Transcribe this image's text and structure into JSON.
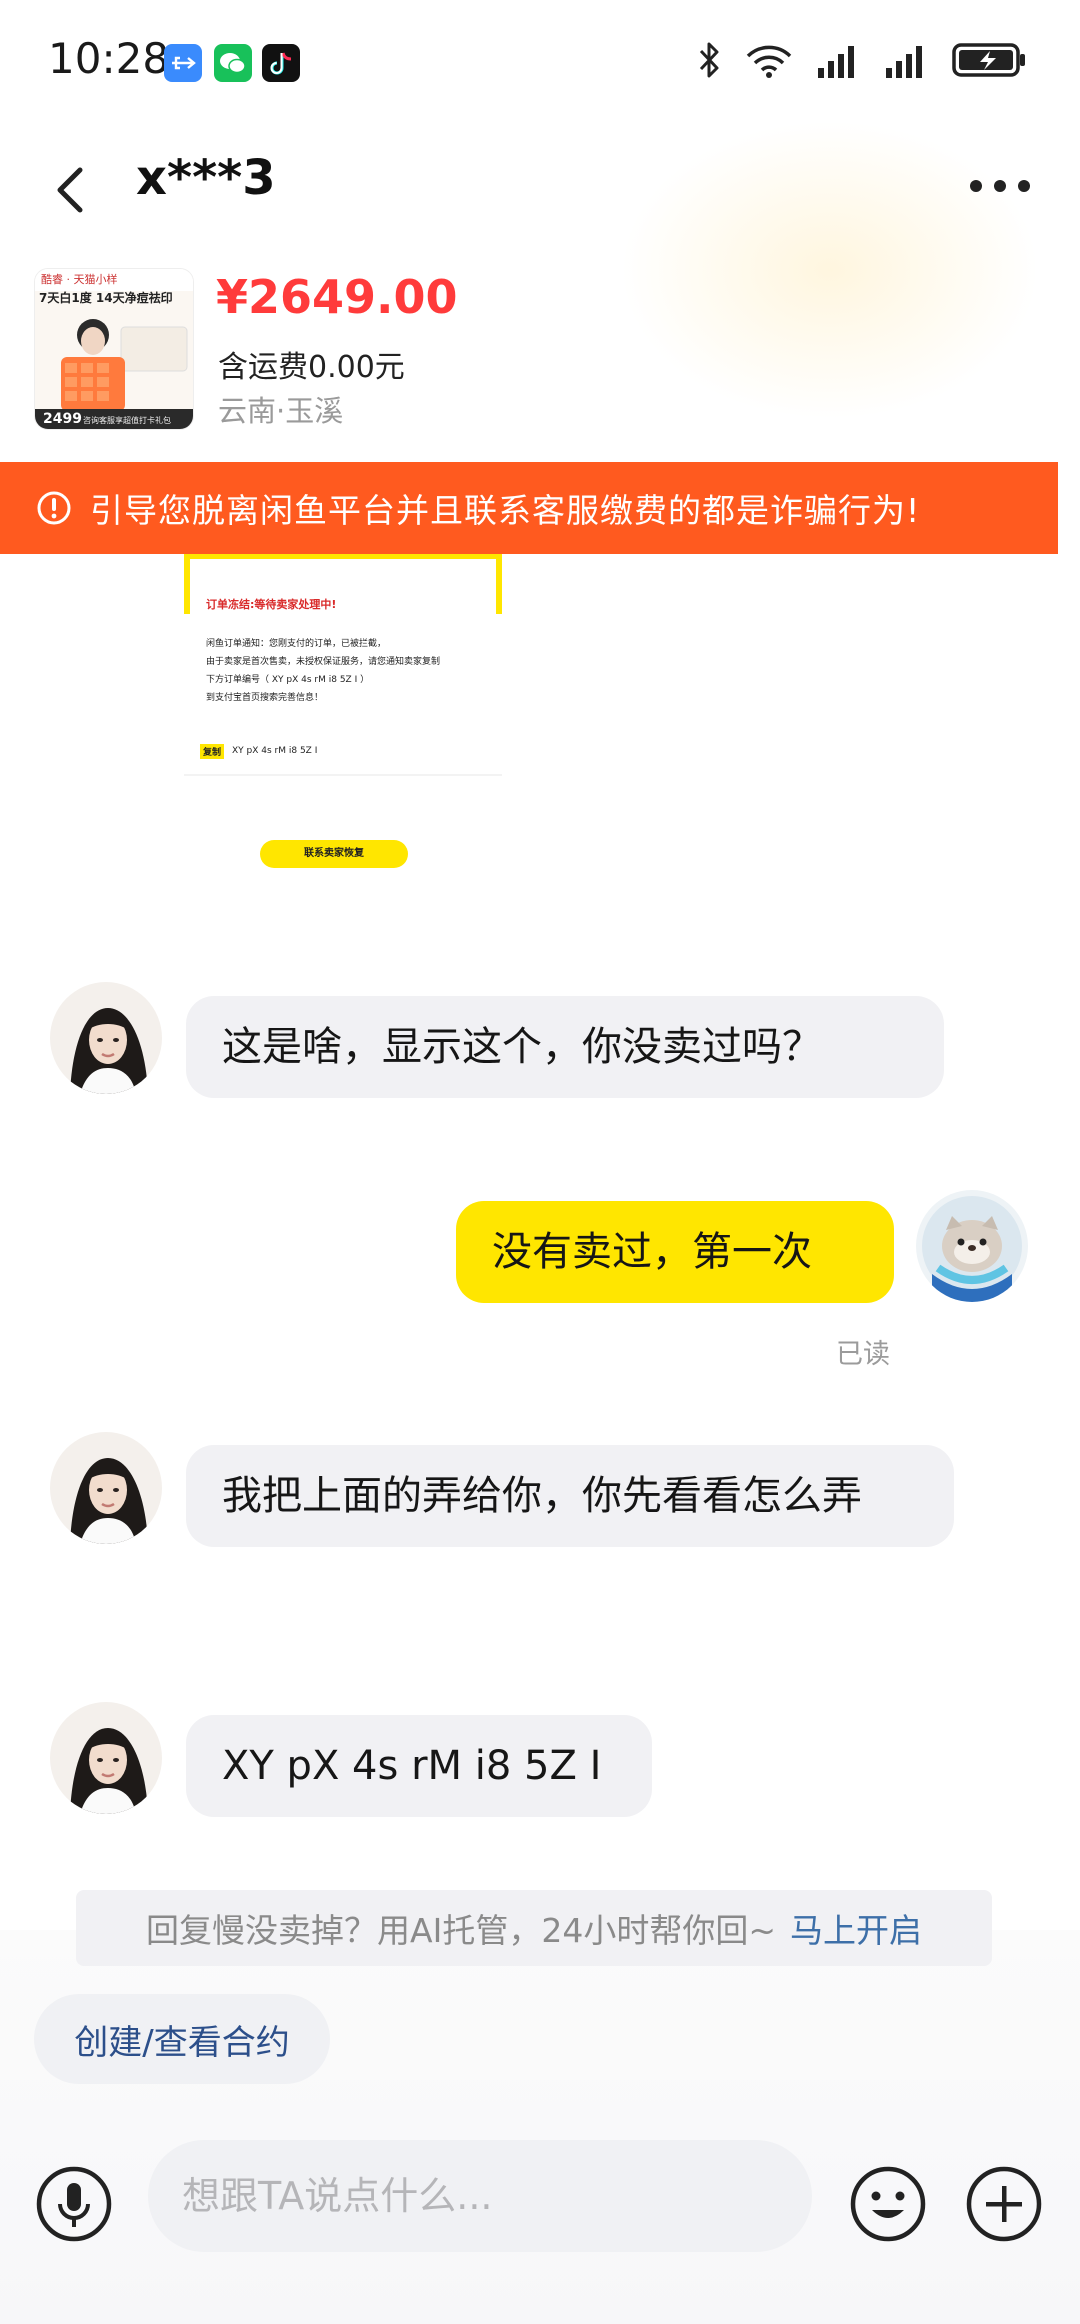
{
  "status_bar": {
    "time": "10:28",
    "app_icons": [
      "usb-debug-icon",
      "wechat-icon",
      "tiktok-icon"
    ],
    "right_icons": [
      "bluetooth-icon",
      "wifi-icon",
      "signal-icon",
      "signal-icon",
      "battery-charging-icon"
    ]
  },
  "header": {
    "title": "x***3"
  },
  "product": {
    "price": "¥2649.00",
    "shipping": "含运费0.00元",
    "location": "云南·玉溪",
    "image": {
      "brand": "酷睿 · 天猫小样",
      "headline": "7天白1度 14天净痘祛印",
      "badge": "2499",
      "footer": "咨询客服享超值打卡礼包"
    }
  },
  "warning": {
    "text": "引导您脱离闲鱼平台并且联系客服缴费的都是诈骗行为!"
  },
  "screenshot_message": {
    "title": "订单冻结:等待卖家处理中!",
    "body": [
      "闲鱼订单通知：您刚支付的订单，已被拦截，",
      "由于卖家是首次售卖，未授权保证服务，请您通知卖家复制",
      "下方订单编号（ XY pX 4s rM i8 5Z I ）",
      "到支付宝首页搜索完善信息！"
    ],
    "copy_tag": "复制",
    "order_code": "XY pX 4s rM i8 5Z I",
    "button": "联系卖家恢复"
  },
  "messages": [
    {
      "side": "in",
      "text": "这是啥，显示这个，你没卖过吗？"
    },
    {
      "side": "out",
      "text": "没有卖过，第一次",
      "status": "已读"
    },
    {
      "side": "in",
      "text": "我把上面的弄给你，你先看看怎么弄"
    },
    {
      "side": "in",
      "text": "XY pX 4s rM i8 5Z I"
    }
  ],
  "ai_tip": {
    "text": "回复慢没卖掉？用AI托管，24小时帮你回~",
    "link": "马上开启"
  },
  "contract_button": "创建/查看合约",
  "input": {
    "placeholder": "想跟TA说点什么..."
  },
  "colors": {
    "warning_bg": "#ff5a1f",
    "price": "#ff3b3b",
    "out_bubble": "#ffe600",
    "in_bubble": "#f1f1f4",
    "link": "#3d6fa8"
  }
}
